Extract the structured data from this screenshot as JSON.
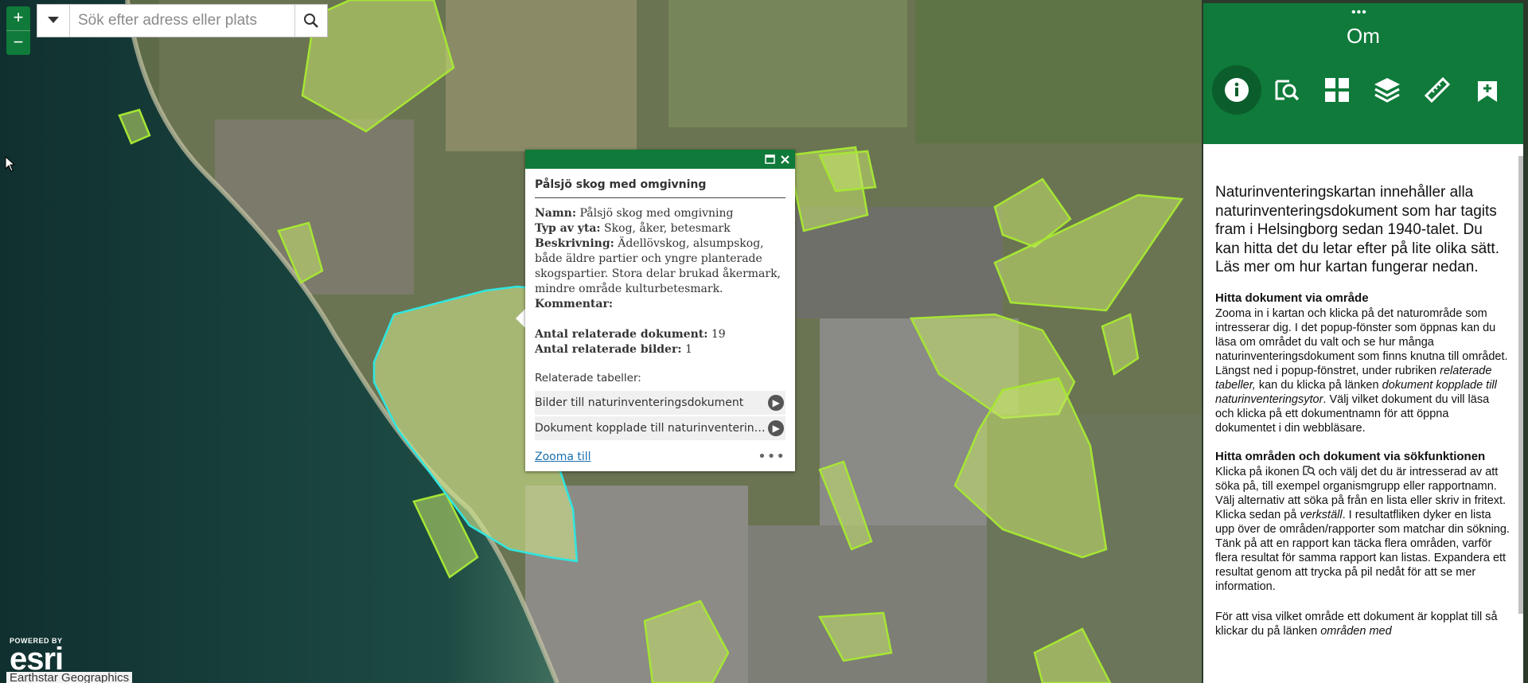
{
  "map": {
    "zoom_in": "+",
    "zoom_out": "−",
    "search_placeholder": "Sök efter adress eller plats",
    "esri_powered": "POWERED BY",
    "esri_logo": "esri",
    "attribution": "Earthstar Geographics",
    "icons": {
      "dropdown": "caret-down-icon",
      "search": "search-icon",
      "maximize": "maximize-icon",
      "close": "close-icon",
      "arrow": "chevron-right-icon"
    }
  },
  "popup": {
    "title": "Pålsjö skog med omgivning",
    "name_label": "Namn:",
    "name_value": " Pålsjö skog med omgivning",
    "type_label": "Typ av yta:",
    "type_value": " Skog, åker, betesmark",
    "desc_label": "Beskrivning:",
    "desc_value": " Ädellövskog, alsumpskog, både äldre partier och yngre planterade skogspartier. Stora delar brukad åkermark, mindre område kulturbetesmark.",
    "comment_label": "Kommentar:",
    "docs_label": "Antal relaterade dokument:",
    "docs_value": " 19",
    "images_label": "Antal relaterade bilder:",
    "images_value": " 1",
    "related_heading": "Relaterade tabeller:",
    "related": [
      "Bilder till naturinventeringsdokument",
      "Dokument kopplade till naturinventeringsytor"
    ],
    "zoom_link": "Zooma till",
    "more": "•••"
  },
  "panel": {
    "title": "Om",
    "tools": [
      "info-icon",
      "query-icon",
      "grid-icon",
      "layers-icon",
      "measure-icon",
      "bookmark-add-icon"
    ],
    "intro": "Naturinventeringskartan innehåller alla naturinventeringsdokument som har tagits fram i Helsingborg sedan 1940-talet. Du kan hitta det du letar efter på lite olika sätt. Läs mer om hur kartan fungerar nedan.",
    "s1_heading": "Hitta dokument via område",
    "s1_a": "Zooma in i kartan och klicka på det naturområde som intresserar dig. I det popup-fönster som öppnas kan du läsa om området du valt och se hur många naturinventeringsdokument som finns knutna till området. Längst ned i popup-fönstret, under rubriken ",
    "s1_b": "relaterade tabeller,",
    "s1_c": " kan du klicka på länken ",
    "s1_d": "dokument kopplade till naturinventeringsytor",
    "s1_e": ". Välj vilket dokument du vill läsa och klicka på ett dokumentnamn för att öppna dokumentet i din webbläsare.",
    "s2_heading": "Hitta områden och dokument via sökfunktionen",
    "s2_a": "Klicka på ikonen ",
    "s2_b": " och välj det du är intresserad av att söka på, till exempel organismgrupp eller rapportnamn. Välj alternativ att söka på från en lista eller skriv in fritext. Klicka sedan på ",
    "s2_c": "verkställ",
    "s2_d": ". I resultatfliken dyker en lista upp över de områden/rapporter som matchar din sökning. Tänk på att en rapport kan täcka flera områden, varför flera resultat för samma rapport kan listas. Expandera ett resultat genom att trycka på pil nedåt för att se mer information.",
    "s3_a": "För att visa vilket område ett dokument är kopplat till så klickar du på länken ",
    "s3_b": "områden med"
  }
}
